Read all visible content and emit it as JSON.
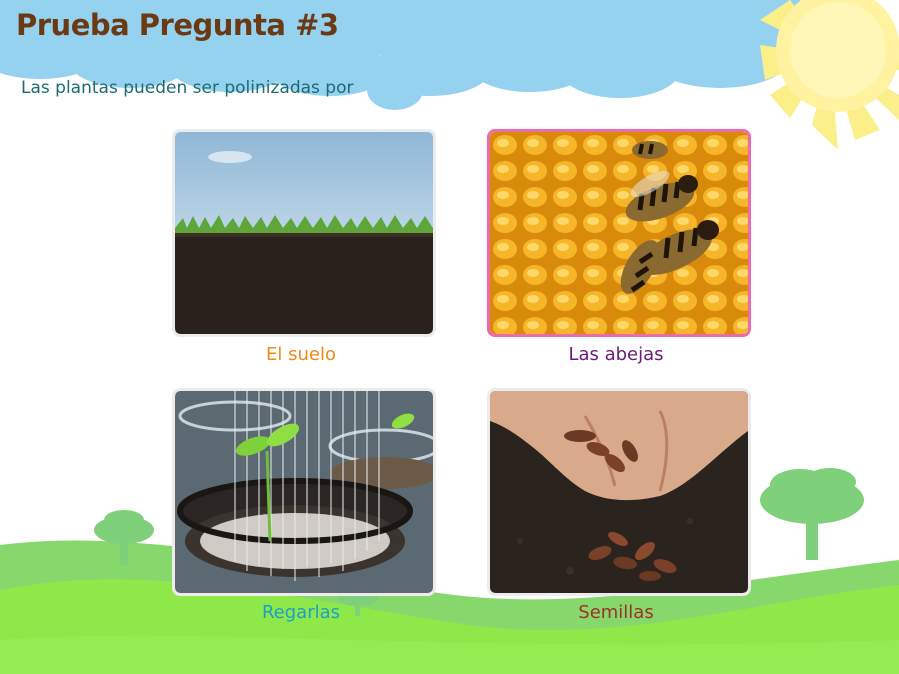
{
  "quiz": {
    "title": "Prueba Pregunta #3",
    "question": "Las plantas pueden ser polinizadas por"
  },
  "options": [
    {
      "label": "El suelo",
      "color": "#f08a14",
      "image": "soil-grass-image",
      "selected": false
    },
    {
      "label": "Las abejas",
      "color": "#6a1a7a",
      "image": "bees-honeycomb-image",
      "selected": true
    },
    {
      "label": "Regarlas",
      "color": "#1e9ec9",
      "image": "watering-seedling-image",
      "selected": false
    },
    {
      "label": "Semillas",
      "color": "#a0302a",
      "image": "hand-seeds-image",
      "selected": false
    }
  ],
  "theme": {
    "title_color": "#6b3a14",
    "question_color": "#1d6b72",
    "selected_border": "#ef6aa8",
    "sky_color": "#94d2ef",
    "grass_color": "#8ee84a"
  }
}
